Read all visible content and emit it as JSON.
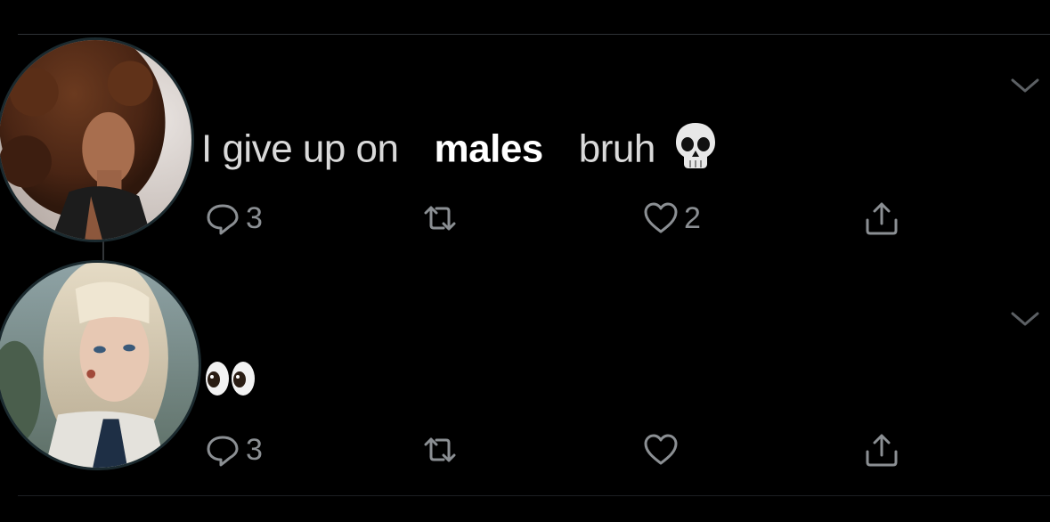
{
  "colors": {
    "background": "#000000",
    "divider": "#2f3336",
    "text_primary": "#d9d9d9",
    "text_emphasis": "#ffffff",
    "icon_gray": "#8b8f93"
  },
  "tweets": [
    {
      "text_words": [
        "I give up on",
        "males",
        "bruh"
      ],
      "emoji": "skull-emoji",
      "avatar": "curly-hair-woman-avatar",
      "actions": {
        "reply_count": "3",
        "retweet_count": "",
        "like_count": "2",
        "share_icon": "share-icon"
      }
    },
    {
      "emoji": "eyes-emoji",
      "avatar": "blonde-woman-avatar",
      "actions": {
        "reply_count": "3",
        "retweet_count": "",
        "like_count": "",
        "share_icon": "share-icon"
      }
    }
  ]
}
